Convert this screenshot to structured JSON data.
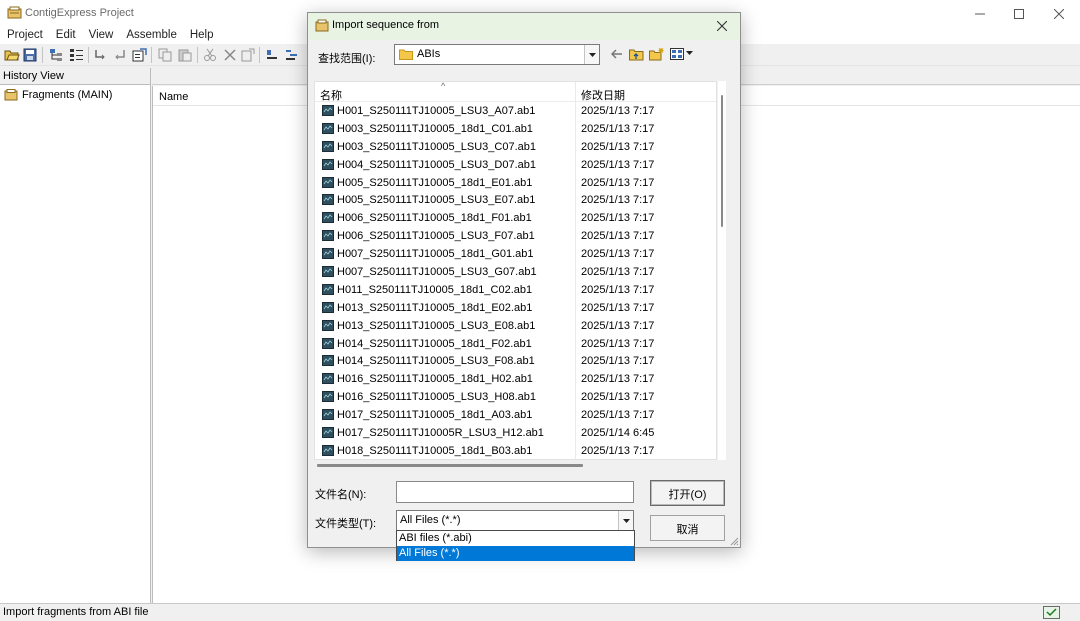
{
  "main_window": {
    "title": "ContigExpress Project",
    "menu": [
      "Project",
      "Edit",
      "View",
      "Assemble",
      "Help"
    ],
    "history_header": "History View",
    "tree_item": "Fragments (MAIN)",
    "name_header": "Name",
    "status_text": "Import fragments from ABI file"
  },
  "dialog": {
    "title": "Import sequence from",
    "lookin_label": "查找范围(I):",
    "lookin_value": "ABIs",
    "col_name": "名称",
    "col_date": "修改日期",
    "files": [
      {
        "name": "H001_S250111TJ10005_LSU3_A07.ab1",
        "date": "2025/1/13 7:17"
      },
      {
        "name": "H003_S250111TJ10005_18d1_C01.ab1",
        "date": "2025/1/13 7:17"
      },
      {
        "name": "H003_S250111TJ10005_LSU3_C07.ab1",
        "date": "2025/1/13 7:17"
      },
      {
        "name": "H004_S250111TJ10005_LSU3_D07.ab1",
        "date": "2025/1/13 7:17"
      },
      {
        "name": "H005_S250111TJ10005_18d1_E01.ab1",
        "date": "2025/1/13 7:17"
      },
      {
        "name": "H005_S250111TJ10005_LSU3_E07.ab1",
        "date": "2025/1/13 7:17"
      },
      {
        "name": "H006_S250111TJ10005_18d1_F01.ab1",
        "date": "2025/1/13 7:17"
      },
      {
        "name": "H006_S250111TJ10005_LSU3_F07.ab1",
        "date": "2025/1/13 7:17"
      },
      {
        "name": "H007_S250111TJ10005_18d1_G01.ab1",
        "date": "2025/1/13 7:17"
      },
      {
        "name": "H007_S250111TJ10005_LSU3_G07.ab1",
        "date": "2025/1/13 7:17"
      },
      {
        "name": "H011_S250111TJ10005_18d1_C02.ab1",
        "date": "2025/1/13 7:17"
      },
      {
        "name": "H013_S250111TJ10005_18d1_E02.ab1",
        "date": "2025/1/13 7:17"
      },
      {
        "name": "H013_S250111TJ10005_LSU3_E08.ab1",
        "date": "2025/1/13 7:17"
      },
      {
        "name": "H014_S250111TJ10005_18d1_F02.ab1",
        "date": "2025/1/13 7:17"
      },
      {
        "name": "H014_S250111TJ10005_LSU3_F08.ab1",
        "date": "2025/1/13 7:17"
      },
      {
        "name": "H016_S250111TJ10005_18d1_H02.ab1",
        "date": "2025/1/13 7:17"
      },
      {
        "name": "H016_S250111TJ10005_LSU3_H08.ab1",
        "date": "2025/1/13 7:17"
      },
      {
        "name": "H017_S250111TJ10005_18d1_A03.ab1",
        "date": "2025/1/13 7:17"
      },
      {
        "name": "H017_S250111TJ10005R_LSU3_H12.ab1",
        "date": "2025/1/14 6:45"
      },
      {
        "name": "H018_S250111TJ10005_18d1_B03.ab1",
        "date": "2025/1/13 7:17"
      }
    ],
    "filename_label": "文件名(N):",
    "filename_value": "",
    "filetype_label": "文件类型(T):",
    "filetype_value": "All Files (*.*)",
    "filetype_options": [
      "ABI files (*.abi)",
      "All Files (*.*)"
    ],
    "filetype_selected_index": 1,
    "open_button": "打开(O)",
    "cancel_button": "取消"
  },
  "colors": {
    "selection": "#0078d7",
    "dialog_title_bg": "#e8f3e4",
    "folder_yellow": "#f3c84a"
  }
}
